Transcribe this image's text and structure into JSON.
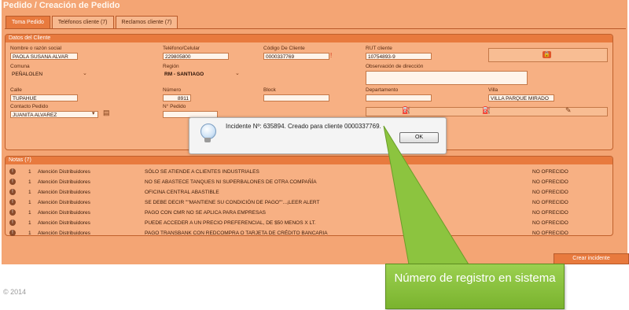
{
  "page": {
    "title": "Pedido / Creación de Pedido",
    "copyright": "© 2014"
  },
  "tabs": [
    {
      "label": "Toma Pedido"
    },
    {
      "label": "Teléfonos cliente (7)"
    },
    {
      "label": "Reclamos cliente (7)"
    }
  ],
  "cliente": {
    "header": "Datos del Cliente",
    "nombre": {
      "label": "Nombre o razón social",
      "value": "PAOLA SUSANA ALVAR"
    },
    "telefono": {
      "label": "Teléfono/Celular",
      "value": "229805800"
    },
    "codigo": {
      "label": "Código De Cliente",
      "value": "0000337769"
    },
    "rut": {
      "label": "RUT cliente",
      "value": "10754893-9"
    },
    "comuna": {
      "label": "Comuna",
      "value": "PEÑALOLEN"
    },
    "region": {
      "label": "Región",
      "value": "RM - SANTIAGO"
    },
    "observacion": {
      "label": "Observación de dirección"
    },
    "calle": {
      "label": "Calle",
      "value": "TUPAHUE"
    },
    "numero": {
      "label": "Número",
      "value": "8911"
    },
    "block": {
      "label": "Block"
    },
    "departamento": {
      "label": "Departamento"
    },
    "villa": {
      "label": "Villa",
      "value": "VILLA PARQUE MIRADO"
    },
    "contacto": {
      "label": "Contacto Pedido",
      "value": "JUANITA ALVAREZ"
    },
    "npedido": {
      "label": "N° Pedido"
    }
  },
  "notas": {
    "header": "Notas (7)",
    "rows": [
      {
        "num": "1",
        "source": "Atención Distribuidores",
        "text": "SÓLO SE ATIENDE A CLIENTES INDUSTRIALES",
        "status": "NO OFRECIDO"
      },
      {
        "num": "1",
        "source": "Atención Distribuidores",
        "text": "NO SE ABASTECE TANQUES NI SUPERBALONES DE OTRA COMPAÑÍA",
        "status": "NO OFRECIDO"
      },
      {
        "num": "1",
        "source": "Atención Distribuidores",
        "text": "OFICINA CENTRAL ABASTIBLE",
        "status": "NO OFRECIDO"
      },
      {
        "num": "1",
        "source": "Atención Distribuidores",
        "text": "SE DEBE DECIR \"\"MANTIENE SU CONDICIÓN DE PAGO\"\"...¡LEER ALERT",
        "status": "NO OFRECIDO"
      },
      {
        "num": "1",
        "source": "Atención Distribuidores",
        "text": "PAGO CON CMR NO SE APLICA PARA EMPRESAS",
        "status": "NO OFRECIDO"
      },
      {
        "num": "1",
        "source": "Atención Distribuidores",
        "text": "PUEDE ACCEDER A UN PRECIO PREFERENCIAL, DE $50 MENOS X LT.",
        "status": "NO OFRECIDO"
      },
      {
        "num": "1",
        "source": "Atención Distribuidores",
        "text": "PAGO TRANSBANK CON REDCOMPRA O TARJETA DE CRÉDITO BANCARIA",
        "status": "NO OFRECIDO"
      }
    ]
  },
  "buttons": {
    "crear": "Crear incidente"
  },
  "dialog": {
    "message": "Incidente Nº: 635894. Creado para cliente 0000337769.",
    "ok": "OK"
  },
  "callout": {
    "text": "Número de registro en sistema"
  },
  "colors": {
    "accent": "#e87a3e",
    "background": "#f4a574",
    "callout": "#8cc43f"
  }
}
